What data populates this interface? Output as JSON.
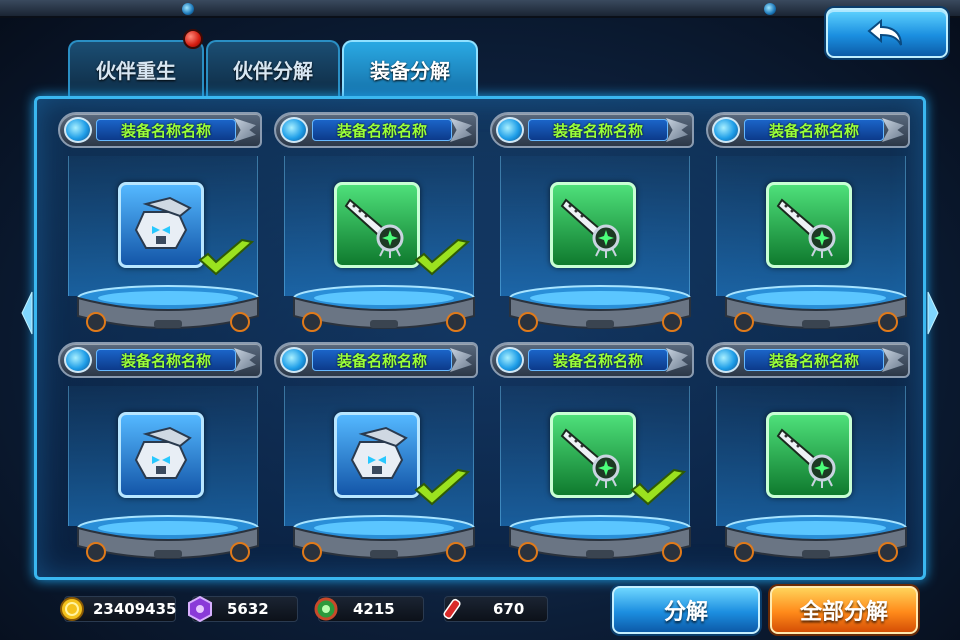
{
  "tabs": [
    {
      "label": "伙伴重生",
      "active": false
    },
    {
      "label": "伙伴分解",
      "active": false
    },
    {
      "label": "装备分解",
      "active": true
    }
  ],
  "slots": [
    {
      "name": "装备名称名称",
      "icon": "robot-head-icon",
      "rarity": "blue",
      "selected": true
    },
    {
      "name": "装备名称名称",
      "icon": "green-blade-weapon-icon",
      "rarity": "green",
      "selected": true
    },
    {
      "name": "装备名称名称",
      "icon": "green-blade-weapon-icon",
      "rarity": "green",
      "selected": false
    },
    {
      "name": "装备名称名称",
      "icon": "green-blade-weapon-icon",
      "rarity": "green",
      "selected": false
    },
    {
      "name": "装备名称名称",
      "icon": "robot-head-icon",
      "rarity": "blue",
      "selected": false
    },
    {
      "name": "装备名称名称",
      "icon": "robot-head-icon",
      "rarity": "blue",
      "selected": true
    },
    {
      "name": "装备名称名称",
      "icon": "green-blade-weapon-icon",
      "rarity": "green",
      "selected": true
    },
    {
      "name": "装备名称名称",
      "icon": "green-blade-weapon-icon",
      "rarity": "green",
      "selected": false
    }
  ],
  "resources": [
    {
      "icon": "gold-coin-icon",
      "value": "23409435"
    },
    {
      "icon": "purple-crystal-icon",
      "value": "5632"
    },
    {
      "icon": "green-orb-icon",
      "value": "4215"
    },
    {
      "icon": "red-vial-icon",
      "value": "670"
    }
  ],
  "buttons": {
    "decompose": "分解",
    "decompose_all": "全部分解"
  },
  "colors": {
    "item_name": "#9aff3a",
    "blue_rarity": "#1f7ad8",
    "green_rarity": "#1fae4a",
    "decompose_button": "#1c8ee0",
    "decompose_all_button": "#ff8a1a"
  }
}
